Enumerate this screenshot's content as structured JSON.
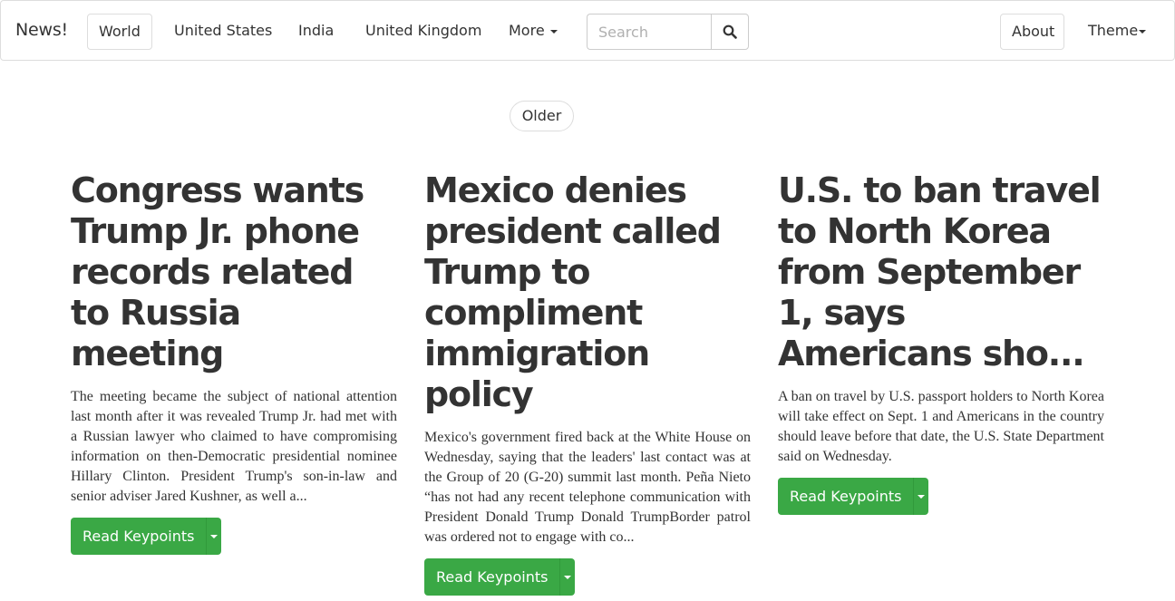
{
  "navbar": {
    "brand": "News!",
    "items": [
      {
        "label": "World",
        "active": true
      },
      {
        "label": "United States"
      },
      {
        "label": "India"
      },
      {
        "label": "United Kingdom"
      },
      {
        "label": "More"
      }
    ],
    "search": {
      "placeholder": "Search",
      "value": "",
      "icon": "search-icon"
    },
    "right_items": [
      {
        "label": "About",
        "active": true
      },
      {
        "label": "Theme"
      }
    ]
  },
  "pagination": {
    "older_label": "Older"
  },
  "articles": [
    {
      "headline": "Congress wants Trump Jr. phone records related to Russia meeting",
      "summary": "The meeting became the subject of national attention last month after it was revealed Trump Jr. had met with a Russian lawyer who claimed to have compromising information on then-Democratic presidential nominee Hillary Clinton. President Trump's son-in-law and senior adviser Jared Kushner, as well a...",
      "button_label": "Read Keypoints"
    },
    {
      "headline": "Mexico denies president called Trump to compliment immigration policy",
      "summary": "Mexico's government fired back at the White House on Wednesday, saying that the leaders' last contact was at the Group of 20 (G-20) summit last month. Peña Nieto “has not had any recent telephone communication with President Donald Trump Donald TrumpBorder patrol was ordered not to engage with co...",
      "button_label": "Read Keypoints"
    },
    {
      "headline": "U.S. to ban travel to North Korea from September 1, says Americans sho...",
      "summary": "A ban on travel by U.S. passport holders to North Korea will take effect on Sept. 1 and Americans in the country should leave before that date, the U.S. State Department said on Wednesday.",
      "button_label": "Read Keypoints"
    }
  ],
  "colors": {
    "accent_green": "#3aa845",
    "border": "#dddddd",
    "text": "#333333"
  }
}
